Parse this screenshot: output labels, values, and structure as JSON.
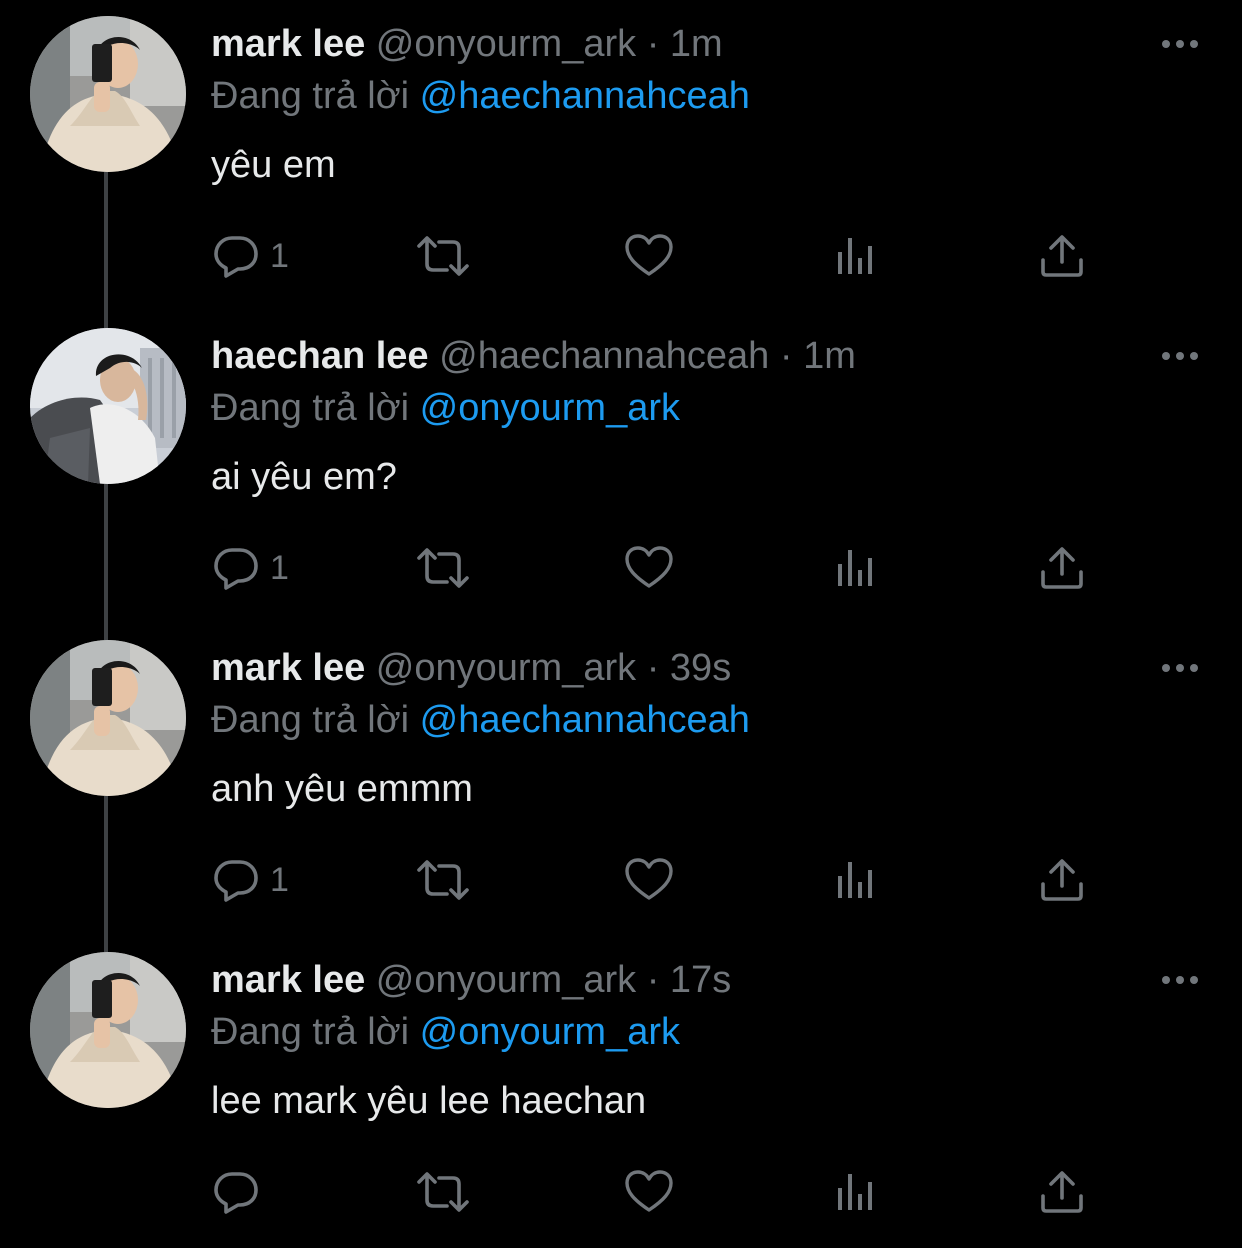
{
  "colors": {
    "background": "#000000",
    "primary_text": "#e7e9ea",
    "secondary_text": "#71767b",
    "mention": "#1d9bf0",
    "thread_line": "#3e4144"
  },
  "tweets": [
    {
      "author": "mark lee",
      "handle": "@onyourm_ark",
      "separator": "·",
      "time": "1m",
      "reply_prefix": "Đang trả lời",
      "reply_to": "@haechannahceah",
      "text": "yêu em",
      "reply_count": "1",
      "avatar": "mark-avatar"
    },
    {
      "author": "haechan lee",
      "handle": "@haechannahceah",
      "separator": "·",
      "time": "1m",
      "reply_prefix": "Đang trả lời",
      "reply_to": "@onyourm_ark",
      "text": "ai yêu em?",
      "reply_count": "1",
      "avatar": "haechan-avatar"
    },
    {
      "author": "mark lee",
      "handle": "@onyourm_ark",
      "separator": "·",
      "time": "39s",
      "reply_prefix": "Đang trả lời",
      "reply_to": "@haechannahceah",
      "text": "anh yêu emmm",
      "reply_count": "1",
      "avatar": "mark-avatar"
    },
    {
      "author": "mark lee",
      "handle": "@onyourm_ark",
      "separator": "·",
      "time": "17s",
      "reply_prefix": "Đang trả lời",
      "reply_to": "@onyourm_ark",
      "text": "lee mark yêu lee haechan",
      "reply_count": "",
      "avatar": "mark-avatar"
    }
  ],
  "icons": {
    "more": "more-horizontal-icon",
    "reply": "reply-bubble-icon",
    "retweet": "retweet-icon",
    "like": "heart-icon",
    "views": "bar-chart-icon",
    "share": "share-upload-icon"
  }
}
